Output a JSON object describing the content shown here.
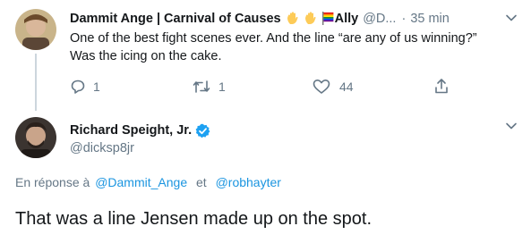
{
  "reply_tweet": {
    "author_name": "Dammit Ange | Carnival of Causes",
    "author_name_suffix": "Ally",
    "author_handle": "@D...",
    "separator": "·",
    "time": "35 min",
    "text_line1": "One of the best fight scenes ever. And the line “are any of us winning?”",
    "text_line2": "Was the icing on the cake.",
    "reply_count": "1",
    "retweet_count": "1",
    "like_count": "44"
  },
  "main_tweet": {
    "author_name": "Richard Speight, Jr.",
    "author_handle": "@dicksp8jr",
    "reply_to_prefix": "En réponse à",
    "reply_to_user1": "@Dammit_Ange",
    "reply_to_and": "et",
    "reply_to_user2": "@robhayter",
    "text": "That was a line Jensen made up on the spot."
  },
  "colors": {
    "link": "#1b95e0",
    "muted": "#657786",
    "verified": "#1da1f2",
    "text": "#14171a"
  },
  "icons": [
    "reply-icon",
    "retweet-icon",
    "like-icon",
    "share-icon",
    "chevron-down-icon",
    "verified-badge-icon",
    "hand-emoji-icon",
    "rainbow-flag-emoji-icon"
  ]
}
